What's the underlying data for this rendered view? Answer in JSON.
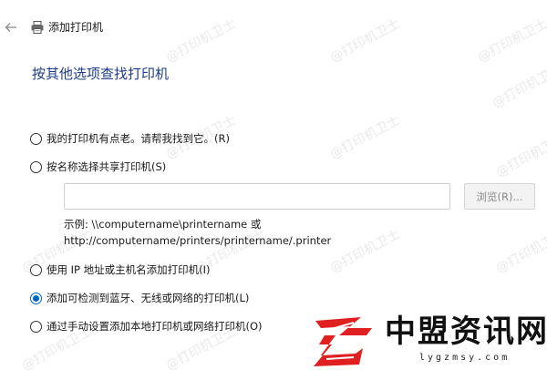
{
  "window": {
    "title": "添加打印机",
    "back_icon": "back-arrow-icon",
    "app_icon": "printer-icon"
  },
  "heading": "按其他选项查找打印机",
  "options": [
    {
      "label": "我的打印机有点老。请帮我找到它。(R)",
      "checked": false
    },
    {
      "label": "按名称选择共享打印机(S)",
      "checked": false
    },
    {
      "label": "使用 IP 地址或主机名添加打印机(I)",
      "checked": false
    },
    {
      "label": "添加可检测到蓝牙、无线或网络的打印机(L)",
      "checked": true
    },
    {
      "label": "通过手动设置添加本地打印机或网络打印机(O)",
      "checked": false
    }
  ],
  "share_printer": {
    "input_value": "",
    "browse_label": "浏览(R)...",
    "example_line1": "示例: \\\\computername\\printername 或",
    "example_line2": "http://computername/printers/printername/.printer"
  },
  "watermark_text": "@打印机卫士",
  "brand": {
    "name": "中盟资讯网",
    "url": "lygzmsy.com"
  },
  "colors": {
    "heading": "#1f3c88",
    "accent": "#0067c0",
    "logo_red": "#e02020"
  }
}
